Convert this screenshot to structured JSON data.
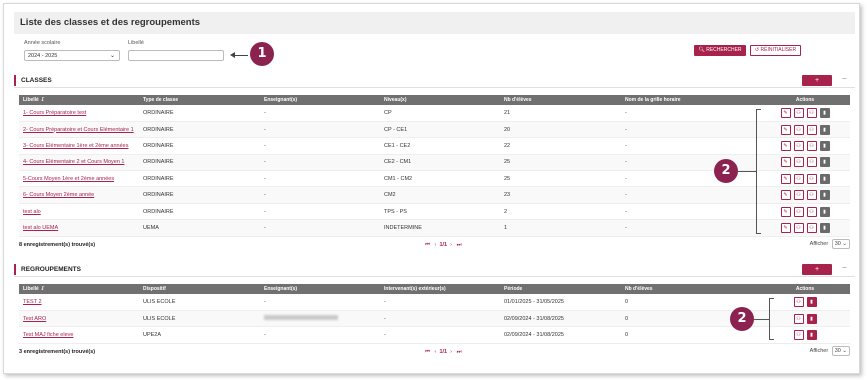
{
  "page": {
    "title": "Liste des classes et des regroupements"
  },
  "filters": {
    "year_label": "Année scolaire",
    "year_value": "2024 - 2025",
    "libelle_label": "Libellé",
    "libelle_value": "",
    "search_label": "RECHERCHER",
    "reset_label": "RÉINITIALISER"
  },
  "callouts": {
    "one": "1",
    "two": "2"
  },
  "classes": {
    "title": "CLASSES",
    "add_label": "+",
    "collapse_label": "−",
    "columns": [
      "Libellé ↓⃗",
      "Type de classe",
      "Enseignant(s)",
      "Niveau(x)",
      "Nb d'élèves",
      "Nom de la grille horaire",
      "Actions"
    ],
    "rows": [
      {
        "libelle": "1- Cours Préparatoire test",
        "type": "ORDINAIRE",
        "enseignant": "-",
        "niveau": "CP",
        "nb": "21",
        "grille": "-"
      },
      {
        "libelle": "2- Cours Préparatoire et Cours Elémentaire 1",
        "type": "ORDINAIRE",
        "enseignant": "-",
        "niveau": "CP - CE1",
        "nb": "20",
        "grille": "-"
      },
      {
        "libelle": "3- Cours Elémentaire 1ère et 2ème années",
        "type": "ORDINAIRE",
        "enseignant": "-",
        "niveau": "CE1 - CE2",
        "nb": "22",
        "grille": "-"
      },
      {
        "libelle": "4- Cours Elémentaire 2 et Cours Moyen 1",
        "type": "ORDINAIRE",
        "enseignant": "-",
        "niveau": "CE2 - CM1",
        "nb": "25",
        "grille": "-"
      },
      {
        "libelle": "5-Cours Moyen 1ère et 2ème années",
        "type": "ORDINAIRE",
        "enseignant": "-",
        "niveau": "CM1 - CM2",
        "nb": "25",
        "grille": "-"
      },
      {
        "libelle": "6- Cours Moyen 2ème année",
        "type": "ORDINAIRE",
        "enseignant": "-",
        "niveau": "CM2",
        "nb": "23",
        "grille": "-"
      },
      {
        "libelle": "test alo",
        "type": "ORDINAIRE",
        "enseignant": "-",
        "niveau": "TPS - PS",
        "nb": "2",
        "grille": "-"
      },
      {
        "libelle": "test alo UEMA",
        "type": "UEMA",
        "enseignant": "-",
        "niveau": "INDETERMINE",
        "nb": "1",
        "grille": "-"
      }
    ],
    "count_text": "8 enregistrement(s) trouvé(s)",
    "pager": {
      "first": "⏮",
      "prev": "‹",
      "page": "1/1",
      "next": "›",
      "last": "⏭"
    },
    "show_label": "Afficher",
    "show_value": "30 ⌄"
  },
  "regroupements": {
    "title": "REGROUPEMENTS",
    "add_label": "+",
    "collapse_label": "−",
    "columns": [
      "Libellé ↓⃗",
      "Dispositif",
      "Enseignant(s)",
      "Intervenant(s) extérieur(s)",
      "Période",
      "Nb d'élèves",
      "Actions"
    ],
    "rows": [
      {
        "libelle": "TEST 2",
        "dispositif": "ULIS ECOLE",
        "enseignant": "-",
        "intervenant": "-",
        "periode": "01/01/2025 - 31/05/2025",
        "nb": "0"
      },
      {
        "libelle": "Test ARO",
        "dispositif": "ULIS ECOLE",
        "enseignant": "",
        "intervenant": "-",
        "periode": "02/09/2024 - 31/08/2025",
        "nb": "0"
      },
      {
        "libelle": "Test MAJ fiche eleve",
        "dispositif": "UPE2A",
        "enseignant": "-",
        "intervenant": "-",
        "periode": "02/09/2024 - 31/08/2025",
        "nb": "0"
      }
    ],
    "count_text": "3 enregistrement(s) trouvé(s)",
    "pager": {
      "first": "⏮",
      "prev": "‹",
      "page": "1/1",
      "next": "›",
      "last": "⏭"
    },
    "show_label": "Afficher",
    "show_value": "30 ⌄"
  },
  "icons": {
    "edit": "pencil-icon",
    "users": "users-icon",
    "user-add": "user-add-icon",
    "delete": "trash-icon"
  },
  "colors": {
    "accent": "#a8234c",
    "callout": "#8b2250",
    "header": "#707070"
  }
}
